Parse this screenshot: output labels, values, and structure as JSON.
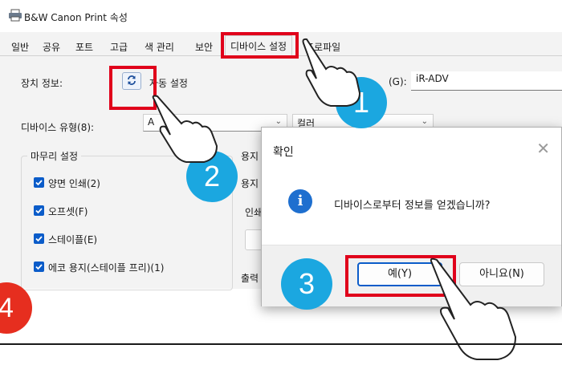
{
  "window": {
    "title": "B&W Canon Print 속성"
  },
  "tabs": [
    "일반",
    "공유",
    "포트",
    "고급",
    "색 관리",
    "보안",
    "디바이스 설정",
    "프로파일"
  ],
  "device_info": {
    "label": "장치 정보:",
    "auto_setting_label": "자동 설정",
    "model_label_suffix": "(G):",
    "model_value": "iR-ADV"
  },
  "device_type": {
    "label": "디바이스 유형(8):",
    "value": "A",
    "color_value": "컬러"
  },
  "finishing": {
    "group_title": "마무리 설정",
    "options": [
      {
        "label": "양면 인쇄(2)",
        "checked": true
      },
      {
        "label": "오프셋(F)",
        "checked": true
      },
      {
        "label": "스테이플(E)",
        "checked": true
      },
      {
        "label": "에코 용지(스테이플 프리)(1)",
        "checked": true
      }
    ]
  },
  "right_panel": {
    "paper_label_1": "용지",
    "paper_label_2": "용지",
    "print_label": "인쇄",
    "output_label": "출력"
  },
  "dialog": {
    "title": "확인",
    "message": "디바이스로부터 정보를 얻겠습니까?",
    "yes_label": "예(Y)",
    "no_label": "아니요(N)",
    "icon": "info-icon"
  },
  "annotations": {
    "markers": [
      "1",
      "2",
      "3",
      "4"
    ],
    "highlight_color": "#e0001b",
    "marker_color": "#1ba7e0",
    "marker4_color": "#e62e1f"
  }
}
